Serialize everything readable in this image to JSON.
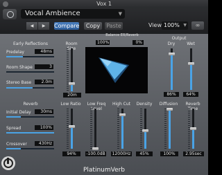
{
  "window": {
    "title": "Vox 1"
  },
  "header": {
    "preset": "Vocal Ambience",
    "compare_label": "Compare",
    "copy_label": "Copy",
    "paste_label": "Paste",
    "view_label": "View:",
    "view_value": "100%",
    "link_icon": "link-icon",
    "prev_icon": "left-triangle-icon",
    "next_icon": "right-triangle-icon"
  },
  "early_reflections": {
    "title": "Early Reflections",
    "predelay": {
      "label": "Predelay",
      "value": "48ms",
      "level": 0.35
    },
    "room_shape": {
      "label": "Room Shape",
      "value": "3",
      "level": 0.0
    },
    "stereo_base": {
      "label": "Stereo Base",
      "value": "2.0m",
      "level": 0.55
    },
    "room_size": {
      "label": "Room Size",
      "value": "20m",
      "level": 0.18
    }
  },
  "balance": {
    "title": "Balance ER/Reverb",
    "left_value": "100%",
    "right_value": "0%"
  },
  "output": {
    "title": "Output",
    "dry": {
      "label": "Dry",
      "value": "86%",
      "level": 0.86
    },
    "wet": {
      "label": "Wet",
      "value": "64%",
      "level": 0.64
    }
  },
  "reverb": {
    "title": "Reverb",
    "initial_delay": {
      "label": "Initial Delay",
      "value": "30ms",
      "level": 0.3
    },
    "spread": {
      "label": "Spread",
      "value": "100%",
      "level": 1.0
    },
    "crossover": {
      "label": "Crossover",
      "value": "430Hz",
      "level": 0.3
    },
    "low_ratio": {
      "label": "Low Ratio",
      "value": "94%",
      "level": 0.55
    },
    "low_freq_level": {
      "label": "Low Freq Level",
      "value": "-100.0dB",
      "level": 0.0
    },
    "high_cut": {
      "label": "High Cut",
      "value": "12000Hz",
      "level": 0.85
    },
    "density": {
      "label": "Density",
      "value": "45%",
      "level": 0.45
    },
    "diffusion": {
      "label": "Diffusion",
      "value": "100%",
      "level": 0.98
    },
    "reverb_time": {
      "label": "Reverb Time",
      "value": "2.95sec",
      "level": 0.5
    }
  },
  "footer": {
    "plugin_name": "PlatinumVerb"
  },
  "colors": {
    "accent": "#4aa3e6",
    "compare": "#3a6fb3",
    "panel_top": "#6e7176",
    "panel_bottom": "#4a4d52"
  }
}
